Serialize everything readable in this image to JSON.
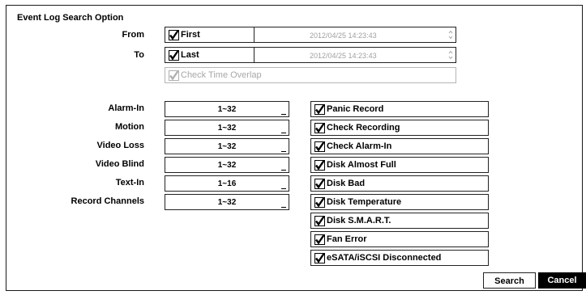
{
  "title": "Event Log Search Option",
  "from": {
    "label": "From",
    "check_label": "First",
    "checked": true,
    "datetime": "2012/04/25  14:23:43"
  },
  "to": {
    "label": "To",
    "check_label": "Last",
    "checked": true,
    "datetime": "2012/04/25  14:23:43"
  },
  "overlap": {
    "label": "Check Time Overlap",
    "checked": true,
    "enabled": false
  },
  "filters": [
    {
      "label": "Alarm-In",
      "value": "1~32"
    },
    {
      "label": "Motion",
      "value": "1~32"
    },
    {
      "label": "Video Loss",
      "value": "1~32"
    },
    {
      "label": "Video Blind",
      "value": "1~32"
    },
    {
      "label": "Text-In",
      "value": "1~16"
    },
    {
      "label": "Record Channels",
      "value": "1~32"
    }
  ],
  "events": [
    {
      "label": "Panic Record",
      "checked": true
    },
    {
      "label": "Check Recording",
      "checked": true
    },
    {
      "label": "Check Alarm-In",
      "checked": true
    },
    {
      "label": "Disk Almost Full",
      "checked": true
    },
    {
      "label": "Disk Bad",
      "checked": true
    },
    {
      "label": "Disk Temperature",
      "checked": true
    },
    {
      "label": "Disk S.M.A.R.T.",
      "checked": true
    },
    {
      "label": "Fan Error",
      "checked": true
    },
    {
      "label": "eSATA/iSCSI Disconnected",
      "checked": true
    }
  ],
  "buttons": {
    "search": "Search",
    "cancel": "Cancel"
  },
  "colors": {
    "checkmark": "#000000",
    "disabled": "#a8a8a8",
    "cancel_bg": "#000000"
  },
  "icons": {
    "checkbox": "checkmark-icon",
    "spinner": "spinner-icon",
    "dropdown": "dropdown-indicator-icon"
  }
}
